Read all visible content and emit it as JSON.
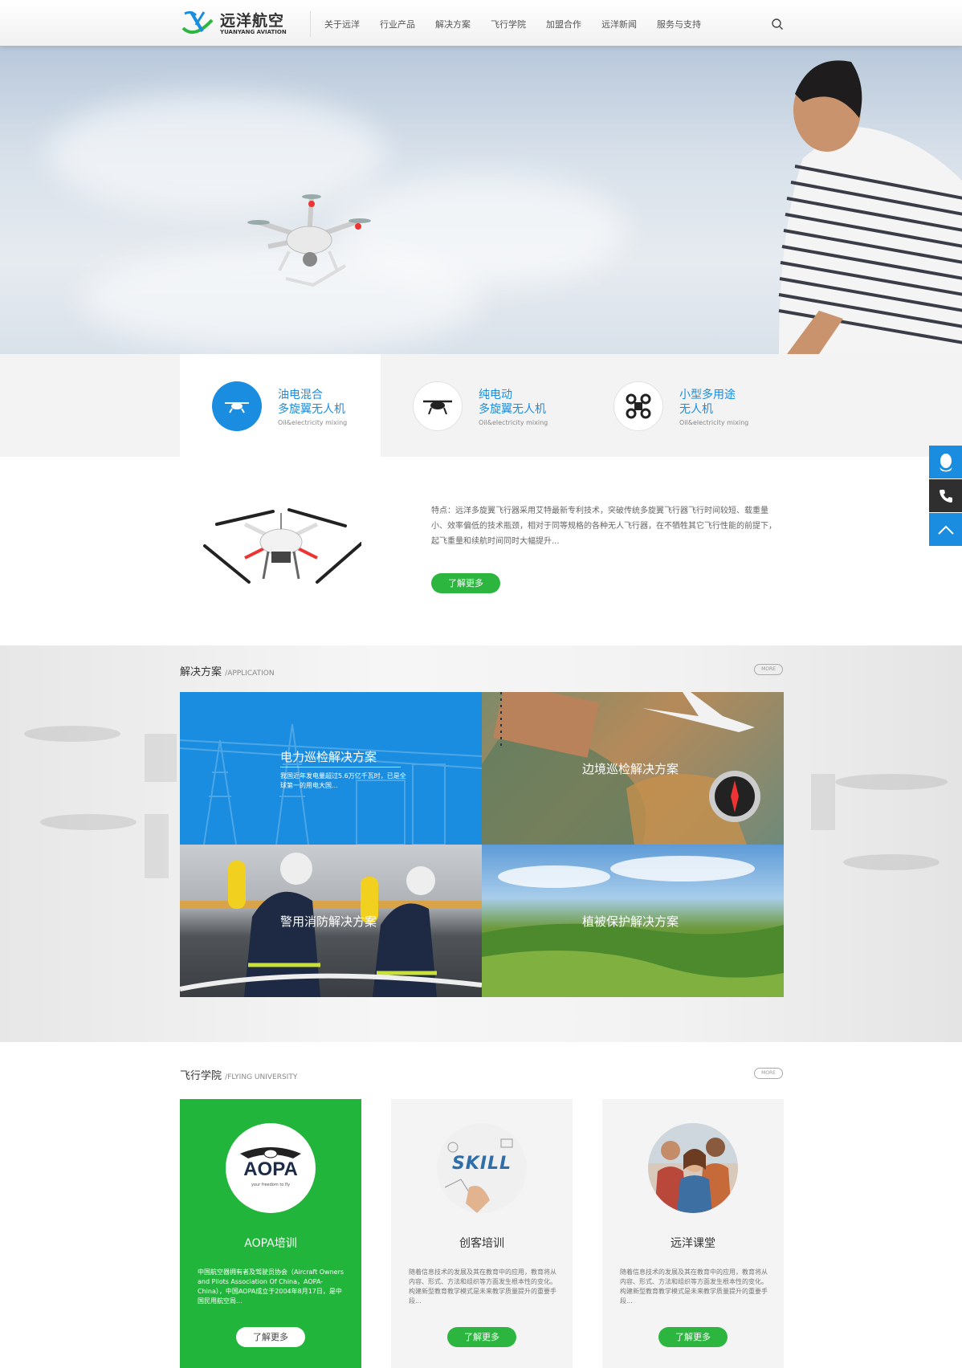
{
  "header": {
    "logo_cn": "远洋航空",
    "logo_en": "YUANYANG AVIATION",
    "nav": [
      "关于远洋",
      "行业产品",
      "解决方案",
      "飞行学院",
      "加盟合作",
      "远洋新闻",
      "服务与支持"
    ]
  },
  "product_tabs": [
    {
      "line1": "油电混合",
      "line2": "多旋翼无人机",
      "sub": "Oil&electricity mixing",
      "icon": "drone-icon",
      "active": true
    },
    {
      "line1": "纯电动",
      "line2": "多旋翼无人机",
      "sub": "Oil&electricity mixing",
      "icon": "drone-icon",
      "active": false
    },
    {
      "line1": "小型多用途",
      "line2": "无人机",
      "sub": "Oil&electricity mixing",
      "icon": "quadcopter-icon",
      "active": false
    }
  ],
  "product": {
    "description": "特点：远洋多旋翼飞行器采用艾特最新专利技术，突破传统多旋翼飞行器飞行时间较短、载重量小、效率偏低的技术瓶颈，相对于同等规格的各种无人飞行器，在不牺牲其它飞行性能的前提下，起飞重量和续航时间同时大幅提升...",
    "button": "了解更多"
  },
  "solutions": {
    "title": "解决方案",
    "subtitle": "/APPLICATION",
    "more": "MORE",
    "tiles": [
      {
        "title": "电力巡检解决方案",
        "desc": "我国近年发电量超过5.6万亿千瓦时，已是全球第一的用电大国..."
      },
      {
        "title": "边境巡检解决方案"
      },
      {
        "title": "警用消防解决方案"
      },
      {
        "title": "植被保护解决方案"
      }
    ]
  },
  "university": {
    "title": "飞行学院",
    "subtitle": "/FLYING UNIVERSITY",
    "more": "MORE",
    "cards": [
      {
        "title": "AOPA培训",
        "logo_text": "AOPA",
        "logo_tag": "your freedom to fly",
        "desc": "中国航空器拥有者及驾驶员协会（Aircraft Owners and Pilots Association Of China，AOPA-China），中国AOPA成立于2004年8月17日，是中国民用航空局...",
        "button": "了解更多"
      },
      {
        "title": "创客培训",
        "image_text": "SKILL",
        "desc": "随着信息技术的发展及其在教育中的应用，教育将从内容、形式、方法和组织等方面发生根本性的变化。构建新型教育教学模式是未来教学质量提升的重要手段...",
        "button": "了解更多"
      },
      {
        "title": "远洋课堂",
        "desc": "随着信息技术的发展及其在教育中的应用，教育将从内容、形式、方法和组织等方面发生根本性的变化。构建新型教育教学模式是未来教学质量提升的重要手段...",
        "button": "了解更多"
      }
    ]
  },
  "sidebar": [
    "qq-icon",
    "phone-icon",
    "back-to-top-icon"
  ],
  "colors": {
    "blue": "#1a8de0",
    "green": "#2cb63f",
    "dark": "#333333"
  }
}
